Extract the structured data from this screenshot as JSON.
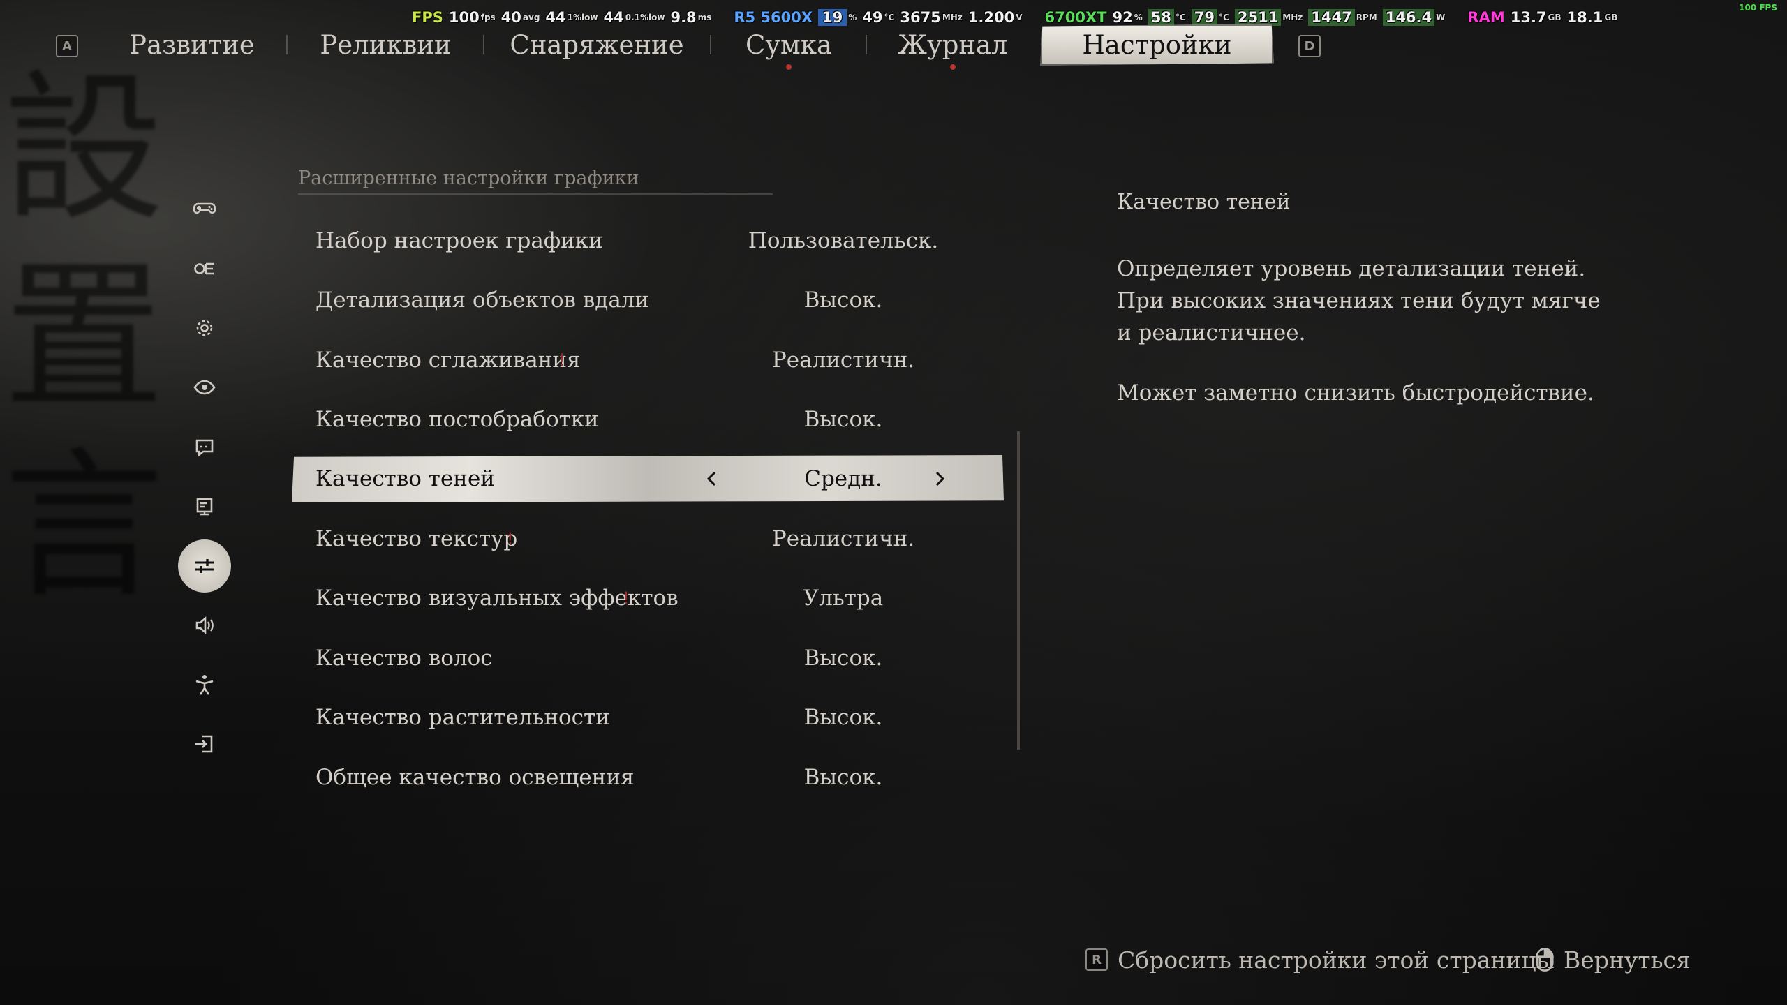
{
  "overlay": {
    "fps_label": "FPS",
    "fps": "100",
    "fps_unit": "fps",
    "fps_avg": "40",
    "fps_avg_unit": "avg",
    "fps_low1": "44",
    "fps_low1_unit": "1%low",
    "fps_low01": "44",
    "fps_low01_unit": "0.1%low",
    "frametime": "9.8",
    "frametime_unit": "ms",
    "cpu_label": "R5 5600X",
    "cpu_load": "19",
    "cpu_load_unit": "%",
    "cpu_temp": "49",
    "cpu_temp_unit": "°C",
    "cpu_clock": "3675",
    "cpu_clock_unit": "MHz",
    "cpu_volt": "1.200",
    "cpu_volt_unit": "V",
    "gpu_label": "6700XT",
    "gpu_load": "92",
    "gpu_load_unit": "%",
    "gpu_temp": "58",
    "gpu_temp_unit": "°C",
    "gpu_hotspot": "79",
    "gpu_hotspot_unit": "°C",
    "gpu_clock": "2511",
    "gpu_clock_unit": "MHz",
    "gpu_fan": "1447",
    "gpu_fan_unit": "RPM",
    "gpu_power": "146.4",
    "gpu_power_unit": "W",
    "ram_label": "RAM",
    "ram_used": "13.7",
    "ram_used_unit": "GB",
    "ram_total": "18.1",
    "ram_total_unit": "GB",
    "corner_fps": "100 FPS"
  },
  "tabs": {
    "prev_key": "A",
    "next_key": "D",
    "items": [
      {
        "label": "Развитие"
      },
      {
        "label": "Реликвии"
      },
      {
        "label": "Снаряжение"
      },
      {
        "label": "Сумка"
      },
      {
        "label": "Журнал"
      },
      {
        "label": "Настройки"
      }
    ],
    "active_index": 5
  },
  "sidebar": {
    "icons": [
      "gamepad-icon",
      "language-icon",
      "gear-icon",
      "eye-icon",
      "subtitles-icon",
      "monitor-icon",
      "sliders-icon",
      "speaker-icon",
      "accessibility-icon",
      "exit-icon"
    ],
    "active_index": 6
  },
  "section": {
    "title": "Расширенные настройки графики"
  },
  "settings": [
    {
      "label": "Набор настроек графики",
      "value": "Пользовательск.",
      "warn": ""
    },
    {
      "label": "Детализация объектов вдали",
      "value": "Высок.",
      "warn": ""
    },
    {
      "label": "Качество сглаживания",
      "value": "Реалистичн.",
      "warn": "!"
    },
    {
      "label": "Качество постобработки",
      "value": "Высок.",
      "warn": ""
    },
    {
      "label": "Качество теней",
      "value": "Средн.",
      "warn": ""
    },
    {
      "label": "Качество текстур",
      "value": "Реалистичн.",
      "warn": "!"
    },
    {
      "label": "Качество визуальных эффектов",
      "value": "Ультра",
      "warn": "!"
    },
    {
      "label": "Качество волос",
      "value": "Высок.",
      "warn": ""
    },
    {
      "label": "Качество растительности",
      "value": "Высок.",
      "warn": ""
    },
    {
      "label": "Общее качество освещения",
      "value": "Высок.",
      "warn": ""
    }
  ],
  "selected_index": 4,
  "description": {
    "title": "Качество теней",
    "body": "Определяет уровень детализации теней. При высоких значениях тени будут мягче и реалистичнее.",
    "note": "Может заметно снизить быстродействие."
  },
  "footer": {
    "reset_key": "R",
    "reset_label": "Сбросить настройки этой страницы",
    "back_label": "Вернуться"
  },
  "colors": {
    "accent_dot": "#b83232",
    "warn": "#9c2b2b",
    "selected_bg": "#dcd9d3",
    "text": "#d4cfc8"
  }
}
